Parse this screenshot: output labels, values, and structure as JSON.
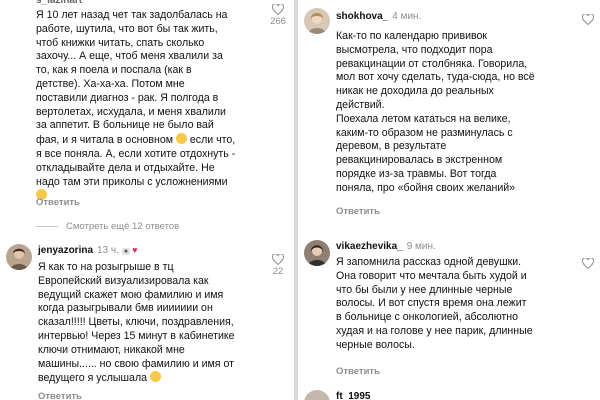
{
  "left": {
    "top_comment": {
      "username": "s_lazinart",
      "text": "Я 10 лет назад чет так задолбалась на\nработе, шутила, что вот бы так жить,\nчтоб книжки читать, спать сколько\nзахочу... А еще, чтоб меня хвалили за\nто, как я поела и поспала (как в\nдетстве). Ха-ха-ха. Потом мне\nпоставили диагноз - рак. Я полгода в\nвертолетах, исхудала, и меня хвалили\nза аппетит. В больнице не было вай\nфая, и я читала в основном",
      "text_tail": " если что,\nя все поняла. А, если хотите отдохнуть -\nоткладывайте дела и отдыхайте. Не\nнадо там эти приколы с усложнениями",
      "likes": "266",
      "reply_label": "Ответить"
    },
    "more_replies": "Смотреть ещё 12 ответов",
    "second_comment": {
      "username": "jenyazorina",
      "time": "13 ч.",
      "text": "Я как то на розыгрыше в тц\nЕвропейский визуализировала как\nведущий скажет мою фамилию и имя\nкогда разыгрывали бмв иииииии он\nсказал!!!!! Цветы, ключи, поздравления,\nинтервью! Через 15 минут в кабинетике\nключи отнимают, никакой мне\nмашины...... но свою фамилию и имя от\nведущего я услышала ",
      "likes": "22",
      "reply_label": "Ответить"
    }
  },
  "right": {
    "first_comment": {
      "username": "shokhova_",
      "time": "4 мин.",
      "text": "Как-то по календарю прививок\nвысмотрела, что подходит пора\nревакцинации от столбняка. Говорила,\nмол вот хочу сделать, туда-сюда, но всё\nникак не доходила до реальных\nдействий.\nПоехала летом кататься на велике,\nкаким-то образом не разминулась с\nдеревом, в результате\nревакцинировалась в экстренном\nпорядке из-за травмы. Вот тогда\nпоняла, про «бойня своих желаний»",
      "reply_label": "Ответить"
    },
    "second_comment": {
      "username": "vikaezhevika_",
      "time": "9 мин.",
      "text": "Я запомнила рассказ одной девушки.\nОна говорит что мечтала быть худой и\nчто бы были у нее длинные черные\nволосы. И вот спустя время она лежит\nв больнице с онкологией, абсолютно\nхудая и на голове у нее парик, длинные\nчерные волосы.",
      "reply_label": "Ответить"
    },
    "partial_username": "ft_1995"
  },
  "colors": {
    "muted": "#8e8e8e",
    "text": "#111111",
    "divider": "#d9d9d9",
    "heart_like": "#e0245e"
  }
}
